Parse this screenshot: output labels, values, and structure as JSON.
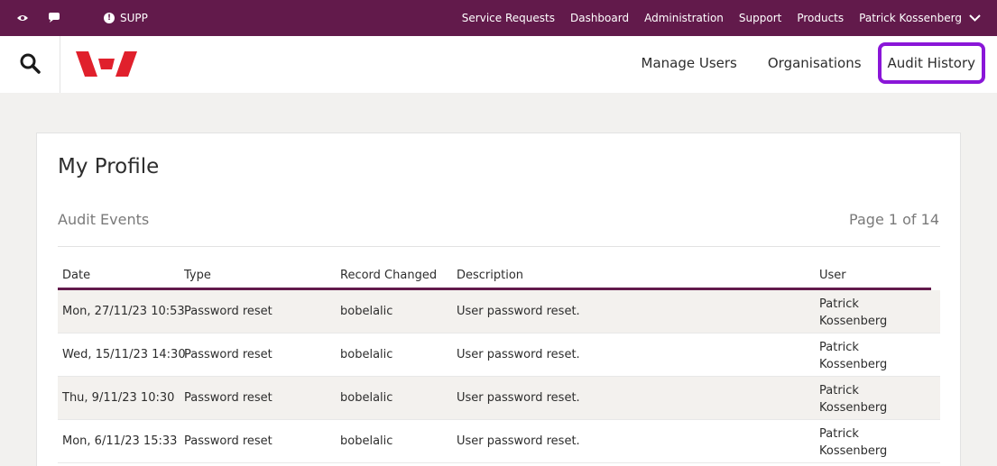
{
  "topbar": {
    "supp_label": "SUPP",
    "nav": [
      "Service Requests",
      "Dashboard",
      "Administration",
      "Support",
      "Products"
    ],
    "user_name": "Patrick Kossenberg"
  },
  "header": {
    "nav": {
      "manage_users": "Manage Users",
      "organisations": "Organisations",
      "audit_history": "Audit History"
    }
  },
  "colors": {
    "brand": "#621a4b",
    "logo_red": "#e0202c",
    "active_outline": "#8a16d8"
  },
  "profile": {
    "title": "My Profile",
    "section": "Audit Events",
    "page_counter": "Page 1 of 14"
  },
  "table": {
    "columns": [
      "Date",
      "Type",
      "Record Changed",
      "Description",
      "User"
    ],
    "rows": [
      {
        "date": "Mon, 27/11/23 10:53",
        "type": "Password reset",
        "record": "bobelalic",
        "description": "User password reset.",
        "user": "Patrick Kossenberg"
      },
      {
        "date": "Wed, 15/11/23 14:30",
        "type": "Password reset",
        "record": "bobelalic",
        "description": "User password reset.",
        "user": "Patrick Kossenberg"
      },
      {
        "date": "Thu, 9/11/23 10:30",
        "type": "Password reset",
        "record": "bobelalic",
        "description": "User password reset.",
        "user": "Patrick Kossenberg"
      },
      {
        "date": "Mon, 6/11/23 15:33",
        "type": "Password reset",
        "record": "bobelalic",
        "description": "User password reset.",
        "user": "Patrick Kossenberg"
      }
    ]
  }
}
